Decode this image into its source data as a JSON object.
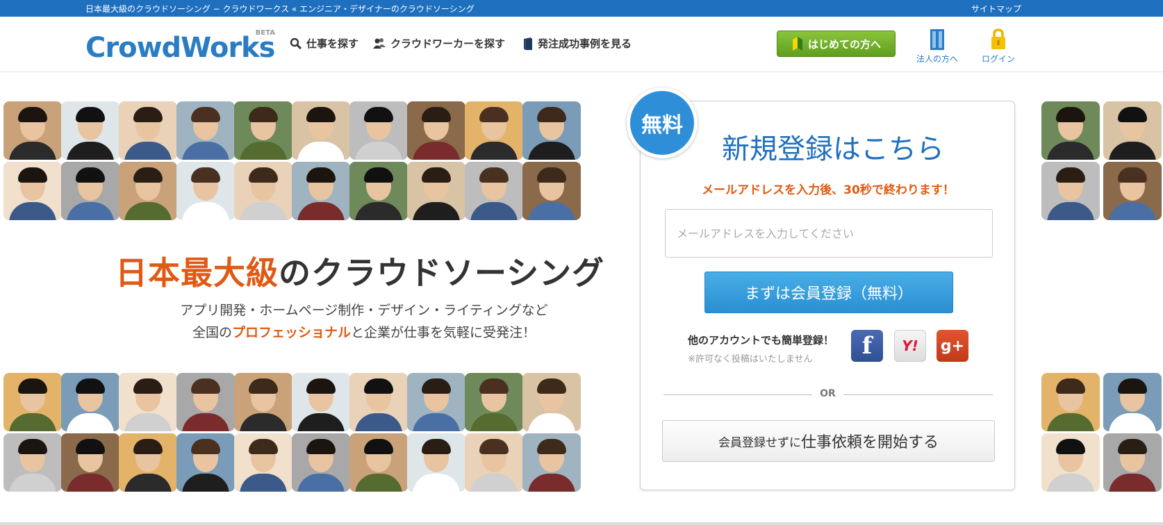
{
  "topbar": {
    "tagline": "日本最大級のクラウドソーシング − クラウドワークス « エンジニア・デザイナーのクラウドソーシング",
    "sitemap_label": "サイトマップ",
    "color": "#1f6fbf"
  },
  "header": {
    "logo_text": "CrowdWorks",
    "logo_badge": "BETA",
    "nav": {
      "search_jobs": "仕事を探す",
      "find_workers": "クラウドワーカーを探す",
      "success_cases": "発注成功事例を見る"
    },
    "first_time_button": "はじめての方へ",
    "corporate_label": "法人の方へ",
    "login_label": "ログイン",
    "icons": [
      "search-icon",
      "people-icon",
      "book-icon",
      "beginner-leaf-icon",
      "building-icon",
      "lock-icon"
    ]
  },
  "hero": {
    "title_accent": "日本最大級",
    "title_rest": "のクラウドソーシング",
    "subtitle_line1": "アプリ開発・ホームページ制作・デザイン・ライティングなど",
    "subtitle_line2_pre": "全国の",
    "subtitle_line2_accent": "プロフェッショナル",
    "subtitle_line2_post": "と企業が仕事を気軽に受発注！",
    "accent_color": "#e05a14"
  },
  "signup": {
    "badge": "無料",
    "title": "新規登録はこちら",
    "note": "メールアドレスを入力後、30秒で終わります！",
    "email_placeholder": "メールアドレスを入力してください",
    "email_value": "",
    "register_button": "まずは会員登録（無料）",
    "other_accounts_label": "他のアカウントでも簡単登録！",
    "other_accounts_note": "※許可なく投稿はいたしません",
    "social": {
      "facebook": "f",
      "yahoo": "Y!",
      "google_plus": "g+"
    },
    "or_text": "OR",
    "request_button_small": "会員登録せずに",
    "request_button_big": "仕事依頼を開始する"
  },
  "photos": {
    "description_icons": "user-photo-icon"
  }
}
